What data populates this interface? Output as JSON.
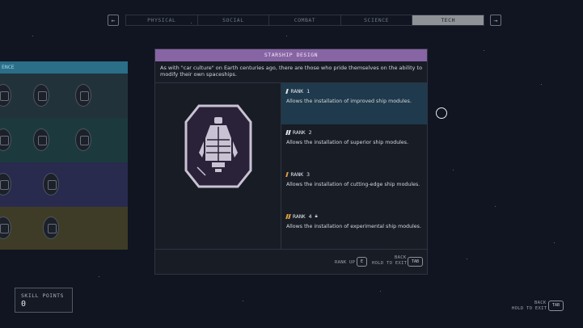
{
  "tabs": {
    "prev_arrow": "←",
    "next_arrow": "→",
    "items": [
      "PHYSICAL",
      "SOCIAL",
      "COMBAT",
      "SCIENCE",
      "TECH"
    ],
    "active": "TECH"
  },
  "left_panel": {
    "header": "ENCE",
    "row_colors": [
      "#22323a",
      "#1c3a3d",
      "#282a4e",
      "#3e3c26"
    ]
  },
  "skill_card": {
    "title": "STARSHIP DESIGN",
    "description": "As with \"car culture\" on Earth centuries ago, there are those who pride themselves on the ability to modify their own spaceships.",
    "badge_icon": "spaceship-icon",
    "ranks": [
      {
        "label": "RANK 1",
        "text": "Allows the installation of improved ship modules.",
        "locked": false,
        "active": true
      },
      {
        "label": "RANK 2",
        "text": "Allows the installation of superior ship modules.",
        "locked": false,
        "active": false
      },
      {
        "label": "RANK 3",
        "text": "Allows the installation of cutting-edge ship modules.",
        "locked": false,
        "active": false
      },
      {
        "label": "RANK 4",
        "text": "Allows the installation of experimental ship modules.",
        "locked": true,
        "active": false
      }
    ],
    "footer": {
      "rank_up_label": "RANK UP",
      "rank_up_key": "E",
      "back_label": "BACK",
      "back_sub": "HOLD TO EXIT",
      "back_key": "TAB"
    }
  },
  "skill_points": {
    "label": "SKILL POINTS",
    "value": "0"
  },
  "corner_back": {
    "label": "BACK",
    "sub": "HOLD TO EXIT",
    "key": "TAB"
  },
  "colors": {
    "accent_purple": "#8764a4",
    "active_rank": "#1f3a4c",
    "tab_active": "#8f9296"
  }
}
